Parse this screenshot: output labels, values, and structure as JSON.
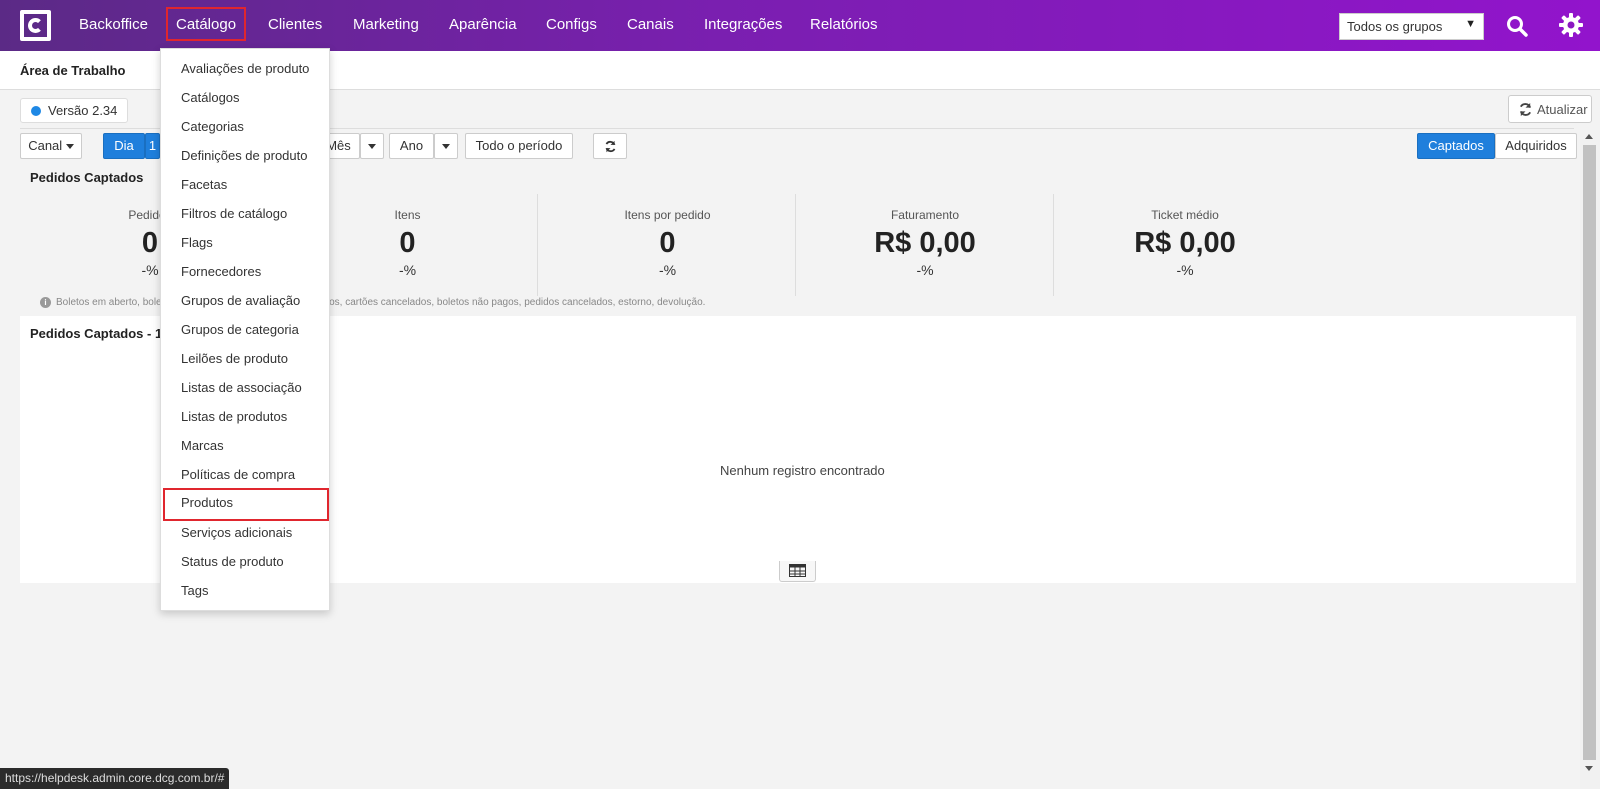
{
  "nav": {
    "items": [
      "Backoffice",
      "Catálogo",
      "Clientes",
      "Marketing",
      "Aparência",
      "Configs",
      "Canais",
      "Integrações",
      "Relatórios"
    ],
    "group_select": "Todos os grupos"
  },
  "header": {
    "title": "Área de Trabalho"
  },
  "version": "Versão 2.34",
  "refresh_label": "Atualizar",
  "filters": {
    "canal": "Canal",
    "dia": "Dia",
    "dia_num": "1",
    "mes": "Mês",
    "ano": "Ano",
    "todo_periodo": "Todo o período",
    "captados": "Captados",
    "adquiridos": "Adquiridos"
  },
  "section_title": "Pedidos Captados",
  "kpis": [
    {
      "label": "Pedidos",
      "value": "0",
      "pct": "-%"
    },
    {
      "label": "Itens",
      "value": "0",
      "pct": "-%"
    },
    {
      "label": "Itens por pedido",
      "value": "0",
      "pct": "-%"
    },
    {
      "label": "Faturamento",
      "value": "R$ 0,00",
      "pct": "-%"
    },
    {
      "label": "Ticket médio",
      "value": "R$ 0,00",
      "pct": "-%"
    }
  ],
  "note_start": "Boletos em aberto, bolet",
  "note_end": "pagos, cartões cancelados, boletos não pagos, pedidos cancelados, estorno, devolução.",
  "chart_title": "Pedidos Captados - 12",
  "empty_message": "Nenhum registro encontrado",
  "dropdown": [
    "Avaliações de produto",
    "Catálogos",
    "Categorias",
    "Definições de produto",
    "Facetas",
    "Filtros de catálogo",
    "Flags",
    "Fornecedores",
    "Grupos de avaliação",
    "Grupos de categoria",
    "Leilões de produto",
    "Listas de associação",
    "Listas de produtos",
    "Marcas",
    "Políticas de compra",
    "Produtos",
    "Serviços adicionais",
    "Status de produto",
    "Tags"
  ],
  "status_url": "https://helpdesk.admin.core.dcg.com.br/#",
  "colors": {
    "nav_start": "#5b2a86",
    "nav_end": "#9214cc",
    "accent_blue": "#1f7fdc",
    "highlight_red": "#e0262e"
  }
}
